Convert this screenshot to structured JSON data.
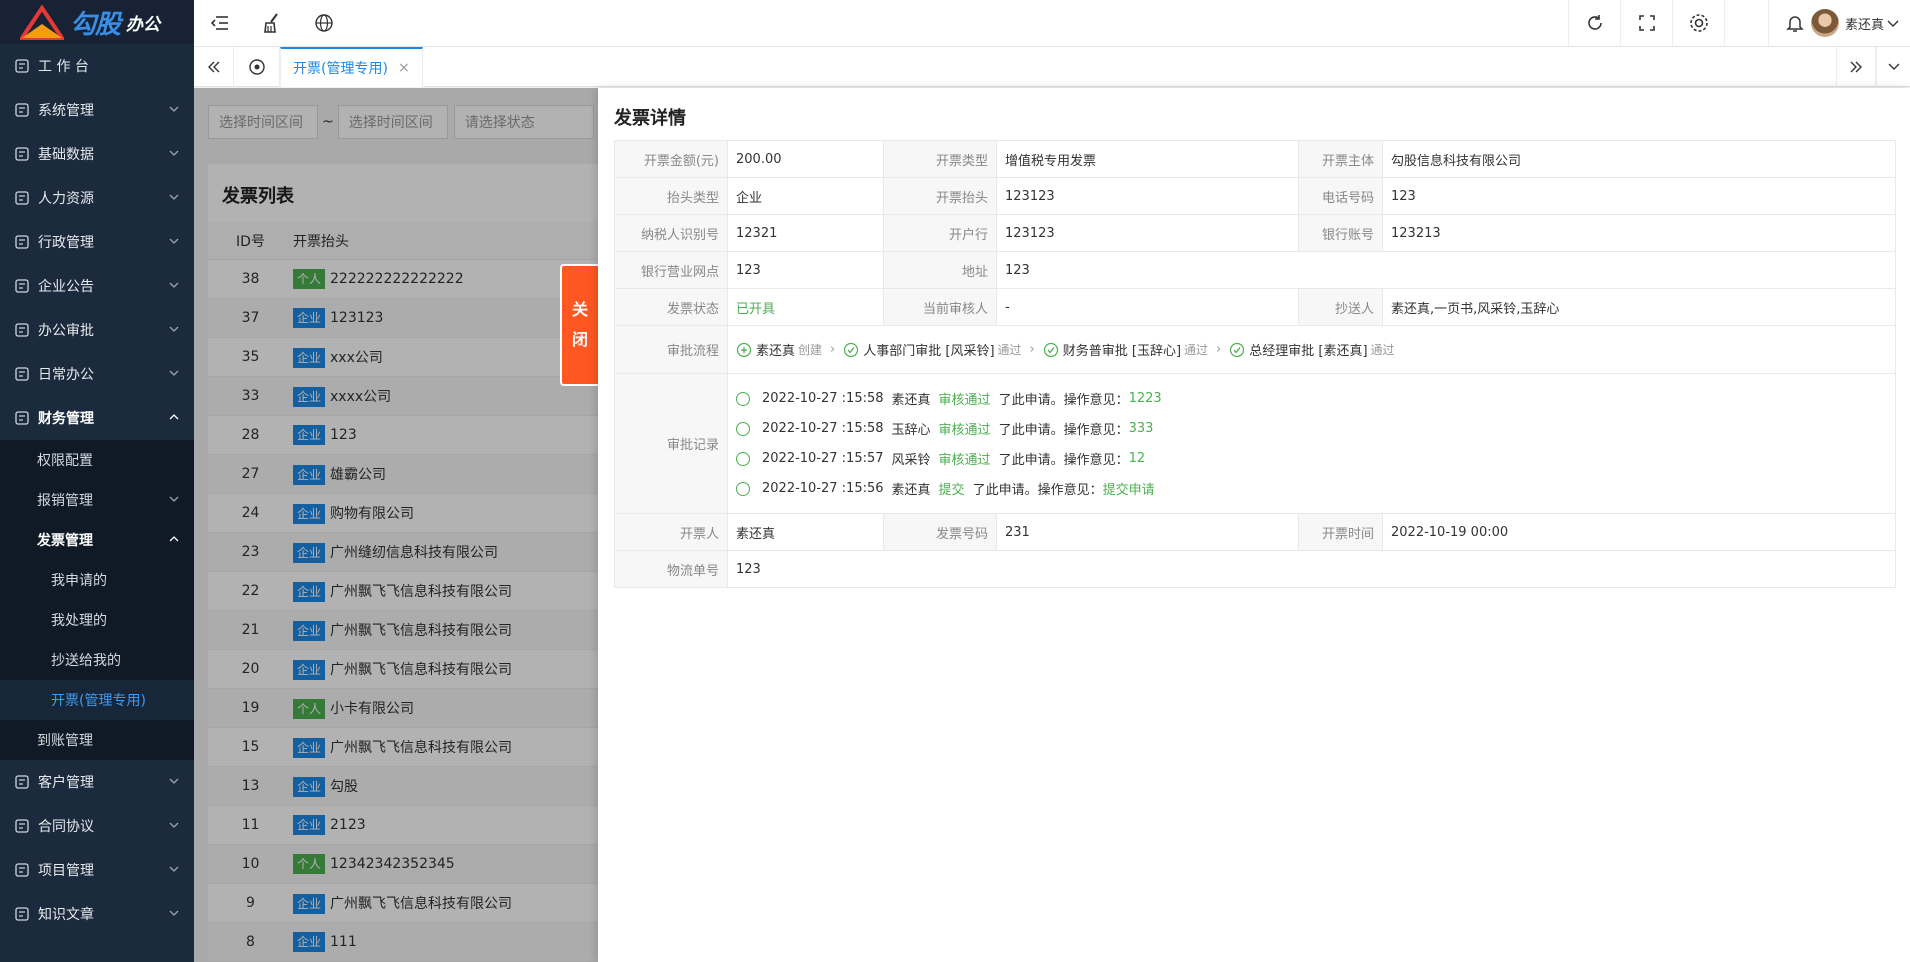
{
  "logo": {
    "text": "勾股",
    "sub": "办公",
    "mark": "OA"
  },
  "sidebar": {
    "items": [
      {
        "label": "工 作 台",
        "icon": "dashboard-icon"
      },
      {
        "label": "系统管理",
        "icon": "settings-icon"
      },
      {
        "label": "基础数据",
        "icon": "database-icon"
      },
      {
        "label": "人力资源",
        "icon": "user-card-icon"
      },
      {
        "label": "行政管理",
        "icon": "admin-icon"
      },
      {
        "label": "企业公告",
        "icon": "bell-icon"
      },
      {
        "label": "办公审批",
        "icon": "approval-icon"
      },
      {
        "label": "日常办公",
        "icon": "calendar-icon"
      },
      {
        "label": "财务管理",
        "icon": "finance-icon"
      }
    ],
    "finance_sub": [
      {
        "label": "权限配置"
      },
      {
        "label": "报销管理"
      },
      {
        "label": "发票管理"
      }
    ],
    "invoice_sub": [
      {
        "label": "我申请的"
      },
      {
        "label": "我处理的"
      },
      {
        "label": "抄送给我的"
      },
      {
        "label": "开票(管理专用)"
      }
    ],
    "finance_sub_after": [
      {
        "label": "到账管理"
      }
    ],
    "items_after": [
      {
        "label": "客户管理",
        "icon": "customer-icon"
      },
      {
        "label": "合同协议",
        "icon": "contract-icon"
      },
      {
        "label": "项目管理",
        "icon": "project-icon"
      },
      {
        "label": "知识文章",
        "icon": "article-icon"
      }
    ]
  },
  "header": {
    "user": "素还真"
  },
  "tabbar": {
    "tab": "开票(管理专用)",
    "close": "×"
  },
  "filters": {
    "start": "选择时间区间",
    "sep": "~",
    "end": "选择时间区间",
    "status": "请选择状态"
  },
  "list": {
    "title": "发票列表",
    "col_id": "ID号",
    "col_title": "开票抬头",
    "rows": [
      {
        "id": "38",
        "type": "个人",
        "name": "222222222222222"
      },
      {
        "id": "37",
        "type": "企业",
        "name": "123123"
      },
      {
        "id": "35",
        "type": "企业",
        "name": "xxx公司"
      },
      {
        "id": "33",
        "type": "企业",
        "name": "xxxx公司"
      },
      {
        "id": "28",
        "type": "企业",
        "name": "123"
      },
      {
        "id": "27",
        "type": "企业",
        "name": "雄霸公司"
      },
      {
        "id": "24",
        "type": "企业",
        "name": "购物有限公司"
      },
      {
        "id": "23",
        "type": "企业",
        "name": "广州缝纫信息科技有限公司"
      },
      {
        "id": "22",
        "type": "企业",
        "name": "广州飘飞飞信息科技有限公司"
      },
      {
        "id": "21",
        "type": "企业",
        "name": "广州飘飞飞信息科技有限公司"
      },
      {
        "id": "20",
        "type": "企业",
        "name": "广州飘飞飞信息科技有限公司"
      },
      {
        "id": "19",
        "type": "个人",
        "name": "小卡有限公司"
      },
      {
        "id": "15",
        "type": "企业",
        "name": "广州飘飞飞信息科技有限公司"
      },
      {
        "id": "13",
        "type": "企业",
        "name": "勾股"
      },
      {
        "id": "11",
        "type": "企业",
        "name": "2123"
      },
      {
        "id": "10",
        "type": "个人",
        "name": "12342342352345"
      },
      {
        "id": "9",
        "type": "企业",
        "name": "广州飘飞飞信息科技有限公司"
      },
      {
        "id": "8",
        "type": "企业",
        "name": "111"
      }
    ]
  },
  "drawer": {
    "close_label": [
      "关",
      "闭"
    ],
    "title": "发票详情",
    "amount_label": "开票金额(元)",
    "amount": "200.00",
    "invtype_label": "开票类型",
    "invtype": "增值税专用发票",
    "subject_label": "开票主体",
    "subject": "勾股信息科技有限公司",
    "headtype_label": "抬头类型",
    "headtype": "企业",
    "head_label": "开票抬头",
    "head": "123123",
    "phone_label": "电话号码",
    "phone": "123",
    "taxid_label": "纳税人识别号",
    "taxid": "12321",
    "bank_label": "开户行",
    "bank": "123123",
    "account_label": "银行账号",
    "account": "123213",
    "branch_label": "银行营业网点",
    "branch": "123",
    "addr_label": "地址",
    "addr": "123",
    "status_label": "发票状态",
    "status": "已开具",
    "checker_label": "当前审核人",
    "checker": "-",
    "cc_label": "抄送人",
    "cc": "素还真,一页书,风采铃,玉辞心",
    "flow_label": "审批流程",
    "flow": [
      {
        "name": "素还真",
        "state": "创建",
        "icon": "plus-circle-icon"
      },
      {
        "name": "人事部门审批 [风采铃]",
        "state": "通过",
        "icon": "check-circle-icon"
      },
      {
        "name": "财务普审批 [玉辞心]",
        "state": "通过",
        "icon": "check-circle-icon"
      },
      {
        "name": "总经理审批 [素还真]",
        "state": "通过",
        "icon": "check-circle-icon"
      }
    ],
    "records_label": "审批记录",
    "records": [
      {
        "time": "2022-10-27 :15:58",
        "user": "素还真",
        "action": "审核通过",
        "text": "了此申请。操作意见：",
        "opinion": "1223"
      },
      {
        "time": "2022-10-27 :15:58",
        "user": "玉辞心",
        "action": "审核通过",
        "text": "了此申请。操作意见：",
        "opinion": "333"
      },
      {
        "time": "2022-10-27 :15:57",
        "user": "风采铃",
        "action": "审核通过",
        "text": "了此申请。操作意见：",
        "opinion": "12"
      },
      {
        "time": "2022-10-27 :15:56",
        "user": "素还真",
        "action": "提交",
        "text": "了此申请。操作意见：",
        "opinion": "提交申请"
      }
    ],
    "issuer_label": "开票人",
    "issuer": "素还真",
    "invno_label": "发票号码",
    "invno": "231",
    "invtime_label": "开票时间",
    "invtime": "2022-10-19 00:00",
    "logistics_label": "物流单号",
    "logistics": "123"
  },
  "colors": {
    "accent": "#1e88e5",
    "success": "#4caf50",
    "close": "#ff5722",
    "sidebar": "#1b2a3d"
  }
}
